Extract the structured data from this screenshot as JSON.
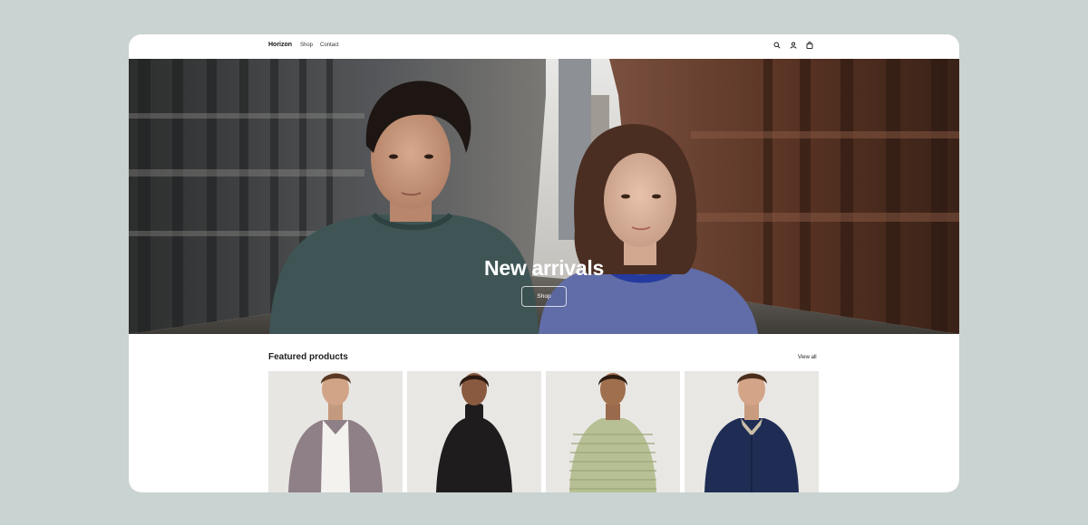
{
  "header": {
    "brand": "Horizon",
    "nav": [
      "Shop",
      "Contact"
    ],
    "icons": [
      "search-icon",
      "account-icon",
      "cart-icon"
    ]
  },
  "hero": {
    "title": "New arrivals",
    "button_label": "Shop"
  },
  "featured": {
    "title": "Featured products",
    "view_all": "View all",
    "products": [
      {
        "image": "man-in-mauve-cardigan"
      },
      {
        "image": "woman-in-black-turtleneck"
      },
      {
        "image": "woman-in-green-striped-sweater"
      },
      {
        "image": "man-in-denim-jacket"
      }
    ]
  },
  "colors": {
    "background": "#c9d3d1",
    "surface": "#ffffff",
    "text": "#1a1a1a",
    "card_background": "#e9e7e4"
  }
}
